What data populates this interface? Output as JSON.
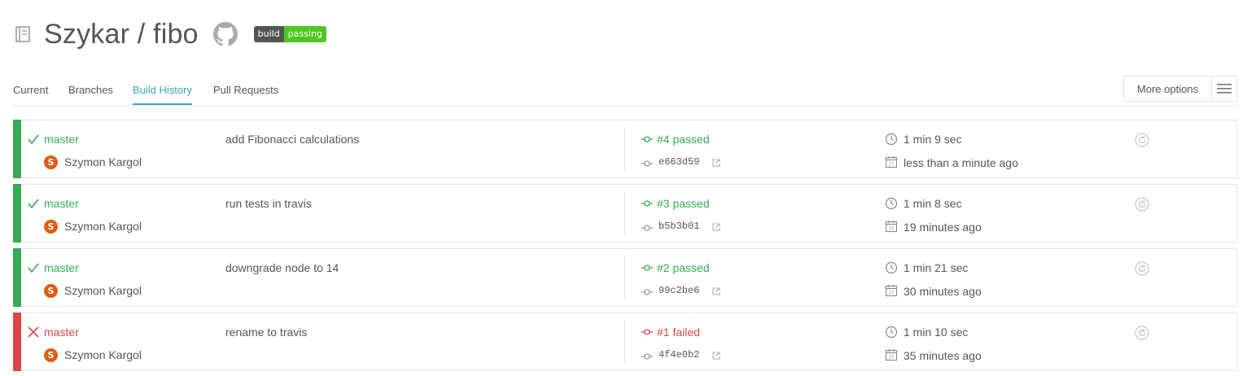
{
  "repo": {
    "owner_name": "Szykar / fibo",
    "badge_label": "build",
    "badge_status": "passing"
  },
  "colors": {
    "passed": "#39aa56",
    "failed": "#db4545",
    "accent": "#3fa5b8",
    "badge_ok": "#4ec820"
  },
  "tabs": [
    {
      "label": "Current",
      "active": false
    },
    {
      "label": "Branches",
      "active": false
    },
    {
      "label": "Build History",
      "active": true
    },
    {
      "label": "Pull Requests",
      "active": false
    }
  ],
  "more_options": {
    "label": "More options",
    "icon": "hamburger-icon"
  },
  "builds": [
    {
      "state": "passed",
      "branch": "master",
      "author": "Szymon Kargol",
      "avatar_letter": "S",
      "message": "add Fibonacci calculations",
      "number_text": "#4 passed",
      "sha": "e663d59",
      "duration": "1 min 9 sec",
      "finished": "less than a minute ago"
    },
    {
      "state": "passed",
      "branch": "master",
      "author": "Szymon Kargol",
      "avatar_letter": "S",
      "message": "run tests in travis",
      "number_text": "#3 passed",
      "sha": "b5b3b01",
      "duration": "1 min 8 sec",
      "finished": "19 minutes ago"
    },
    {
      "state": "passed",
      "branch": "master",
      "author": "Szymon Kargol",
      "avatar_letter": "S",
      "message": "downgrade node to 14",
      "number_text": "#2 passed",
      "sha": "99c2be6",
      "duration": "1 min 21 sec",
      "finished": "30 minutes ago"
    },
    {
      "state": "failed",
      "branch": "master",
      "author": "Szymon Kargol",
      "avatar_letter": "S",
      "message": "rename to travis",
      "number_text": "#1 failed",
      "sha": "4f4e0b2",
      "duration": "1 min 10 sec",
      "finished": "35 minutes ago"
    }
  ]
}
